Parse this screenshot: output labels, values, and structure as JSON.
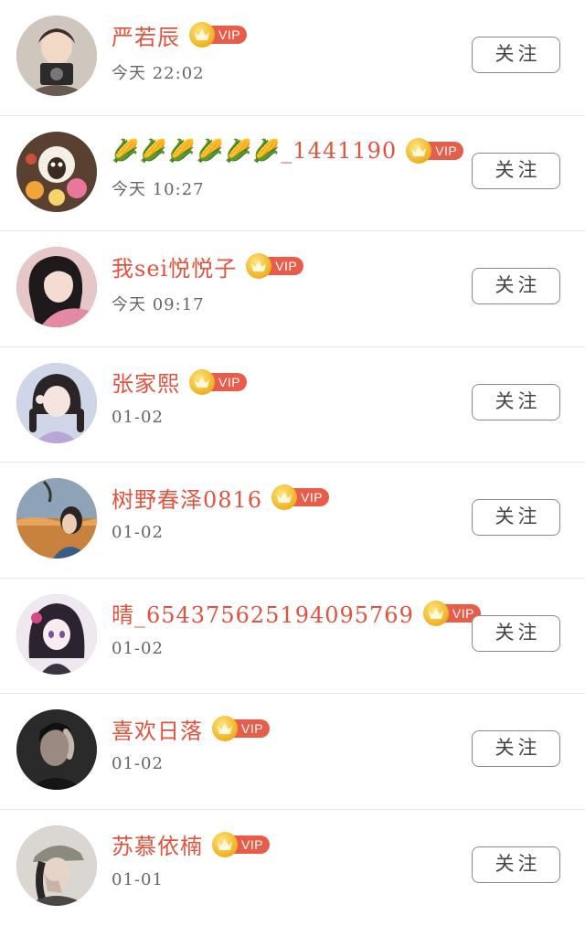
{
  "follow_label": "关注",
  "vip_label": "VIP",
  "accent_color": "#e0533f",
  "users": [
    {
      "name": "严若辰",
      "time": "今天 22:02"
    },
    {
      "name": "🌽🌽🌽🌽🌽🌽_1441190",
      "time": "今天 10:27"
    },
    {
      "name": "我sei悦悦子",
      "time": "今天 09:17"
    },
    {
      "name": "张家熙",
      "time": "01-02"
    },
    {
      "name": "树野春泽0816",
      "time": "01-02"
    },
    {
      "name": "晴_654375625194095769",
      "time": "01-02"
    },
    {
      "name": "喜欢日落",
      "time": "01-02"
    },
    {
      "name": "苏慕依楠",
      "time": "01-01"
    }
  ]
}
